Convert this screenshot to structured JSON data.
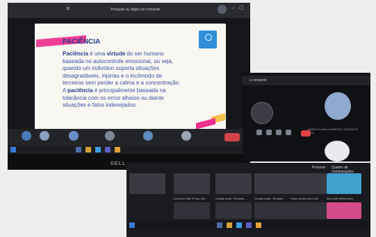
{
  "teams_window": {
    "search_placeholder": "Pesquise ou digite um comando"
  },
  "slide": {
    "title": "PACIÊNCIA",
    "body_parts": [
      {
        "text": "Paciência",
        "bold": true
      },
      {
        "text": " é uma ",
        "bold": false
      },
      {
        "text": "virtude",
        "bold": true
      },
      {
        "text": " do ser humano baseada no autocontrole emocional, ou seja, quando um indivíduo suporta situações desagradáveis, injúrias e o incômodo de terceiros sem perder a calma e a concentração. A ",
        "bold": false
      },
      {
        "text": "paciência",
        "bold": true
      },
      {
        "text": " é principalmente baseada na tolerância com os erros alheios ou diante situações e fatos indesejados.",
        "bold": false
      }
    ]
  },
  "laptop_brand": "DELL",
  "second_window": {
    "title": "u comando",
    "participant_name": "MARIA CLARA LOURENÇO SOUZA DO ROC"
  },
  "file_board": {
    "menu": [
      "Procurar",
      "Quadro de comunicações"
    ],
    "files": [
      "Encontro PAE 6º ano (Re...",
      "Oração atual - Reunião ...",
      "Oração atual - Reunião ...",
      "Vídeo de alunos e fort..."
    ],
    "whiteboard_label": "Microsoft Whiteboard"
  },
  "colors": {
    "slide_title": "#2b3b8a",
    "slide_accent_pink": "#ef2f8f",
    "slide_accent_yellow": "#f2c14a",
    "hangup_red": "#d2444a",
    "whiteboard_blue": "#3ea2c9"
  }
}
